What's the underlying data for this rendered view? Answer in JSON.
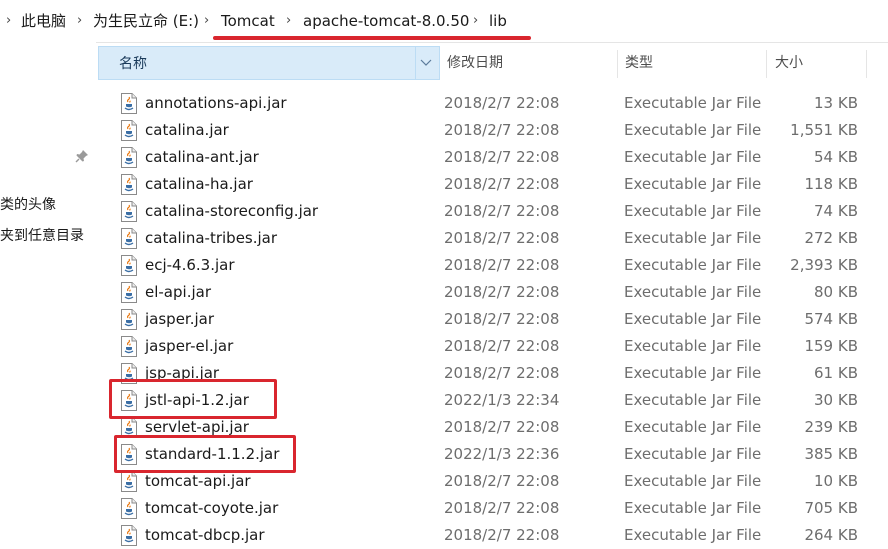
{
  "breadcrumb": {
    "items": [
      "此电脑",
      "为生民立命 (E:)",
      "Tomcat",
      "apache-tomcat-8.0.50",
      "lib"
    ],
    "separator": "›"
  },
  "nav": {
    "item1": "类的头像",
    "item2": "夹到任意目录"
  },
  "columns": {
    "name": "名称",
    "date": "修改日期",
    "type": "类型",
    "size": "大小"
  },
  "files": [
    {
      "name": "annotations-api.jar",
      "date": "2018/2/7 22:08",
      "type": "Executable Jar File",
      "size": "13 KB"
    },
    {
      "name": "catalina.jar",
      "date": "2018/2/7 22:08",
      "type": "Executable Jar File",
      "size": "1,551 KB"
    },
    {
      "name": "catalina-ant.jar",
      "date": "2018/2/7 22:08",
      "type": "Executable Jar File",
      "size": "54 KB"
    },
    {
      "name": "catalina-ha.jar",
      "date": "2018/2/7 22:08",
      "type": "Executable Jar File",
      "size": "118 KB"
    },
    {
      "name": "catalina-storeconfig.jar",
      "date": "2018/2/7 22:08",
      "type": "Executable Jar File",
      "size": "74 KB"
    },
    {
      "name": "catalina-tribes.jar",
      "date": "2018/2/7 22:08",
      "type": "Executable Jar File",
      "size": "272 KB"
    },
    {
      "name": "ecj-4.6.3.jar",
      "date": "2018/2/7 22:08",
      "type": "Executable Jar File",
      "size": "2,393 KB"
    },
    {
      "name": "el-api.jar",
      "date": "2018/2/7 22:08",
      "type": "Executable Jar File",
      "size": "80 KB"
    },
    {
      "name": "jasper.jar",
      "date": "2018/2/7 22:08",
      "type": "Executable Jar File",
      "size": "574 KB"
    },
    {
      "name": "jasper-el.jar",
      "date": "2018/2/7 22:08",
      "type": "Executable Jar File",
      "size": "159 KB"
    },
    {
      "name": "jsp-api.jar",
      "date": "2018/2/7 22:08",
      "type": "Executable Jar File",
      "size": "61 KB"
    },
    {
      "name": "jstl-api-1.2.jar",
      "date": "2022/1/3 22:34",
      "type": "Executable Jar File",
      "size": "30 KB"
    },
    {
      "name": "servlet-api.jar",
      "date": "2018/2/7 22:08",
      "type": "Executable Jar File",
      "size": "239 KB"
    },
    {
      "name": "standard-1.1.2.jar",
      "date": "2022/1/3 22:36",
      "type": "Executable Jar File",
      "size": "385 KB"
    },
    {
      "name": "tomcat-api.jar",
      "date": "2018/2/7 22:08",
      "type": "Executable Jar File",
      "size": "10 KB"
    },
    {
      "name": "tomcat-coyote.jar",
      "date": "2018/2/7 22:08",
      "type": "Executable Jar File",
      "size": "705 KB"
    },
    {
      "name": "tomcat-dbcp.jar",
      "date": "2018/2/7 22:08",
      "type": "Executable Jar File",
      "size": "264 KB"
    }
  ],
  "colors": {
    "highlight_red": "#d9262e",
    "header_selected": "#d9ebf9"
  }
}
